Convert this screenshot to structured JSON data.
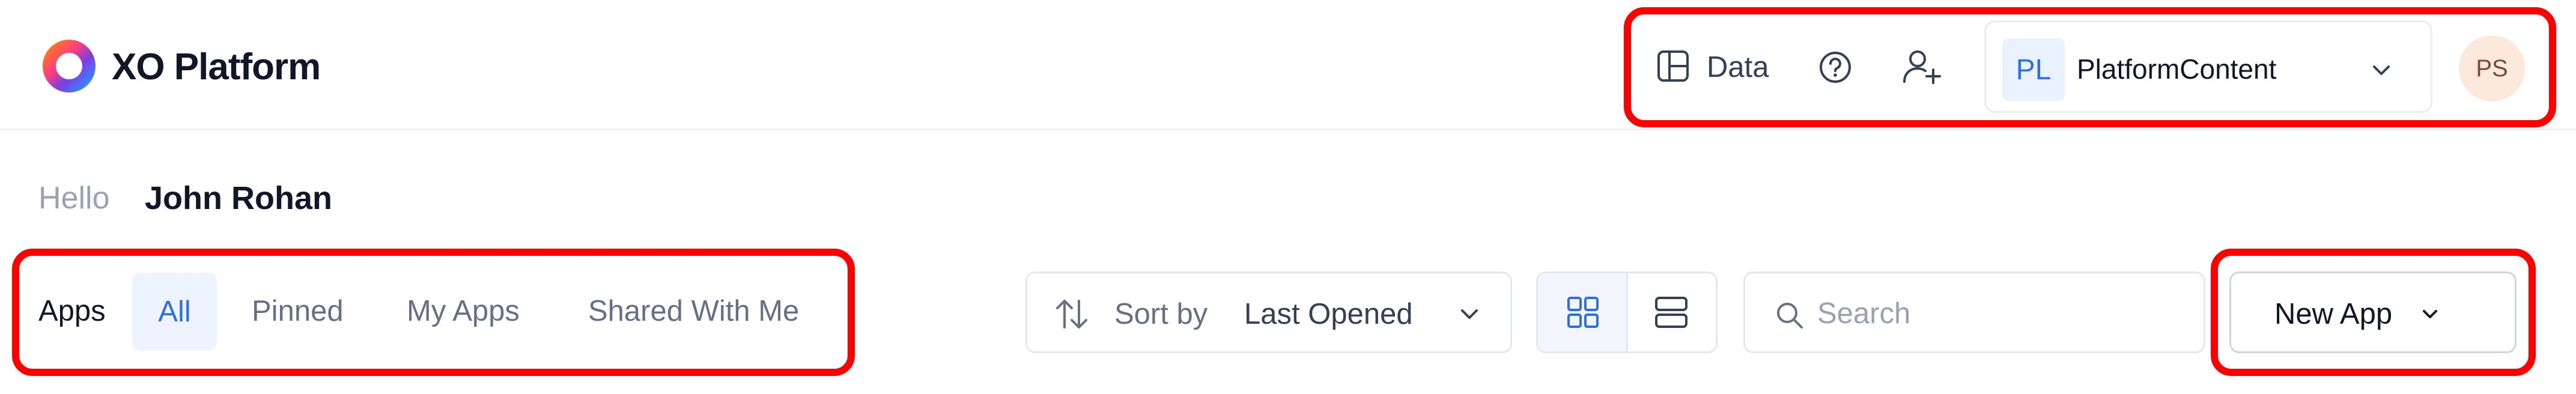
{
  "brand": {
    "name": "XO Platform",
    "icon": "ring-logo-icon"
  },
  "header": {
    "data_label": "Data",
    "data_icon": "layout-panel-icon",
    "help_icon": "help-circle-icon",
    "add_user_icon": "add-user-icon",
    "workspace": {
      "badge": "PL",
      "name": "PlatformContent"
    },
    "avatar_initials": "PS"
  },
  "greeting": {
    "hello": "Hello",
    "user_name": "John Rohan"
  },
  "apps": {
    "label": "Apps",
    "tabs": [
      {
        "label": "All",
        "active": true
      },
      {
        "label": "Pinned",
        "active": false
      },
      {
        "label": "My Apps",
        "active": false
      },
      {
        "label": "Shared With Me",
        "active": false
      }
    ]
  },
  "sort": {
    "label": "Sort by",
    "value": "Last Opened"
  },
  "view": {
    "grid_icon": "grid-view-icon",
    "list_icon": "list-view-icon",
    "selected": "grid"
  },
  "search": {
    "placeholder": "Search"
  },
  "new_app": {
    "label": "New App"
  },
  "colors": {
    "accent": "#2F6FE4",
    "highlight": "#FF0000",
    "muted": "#667085"
  }
}
